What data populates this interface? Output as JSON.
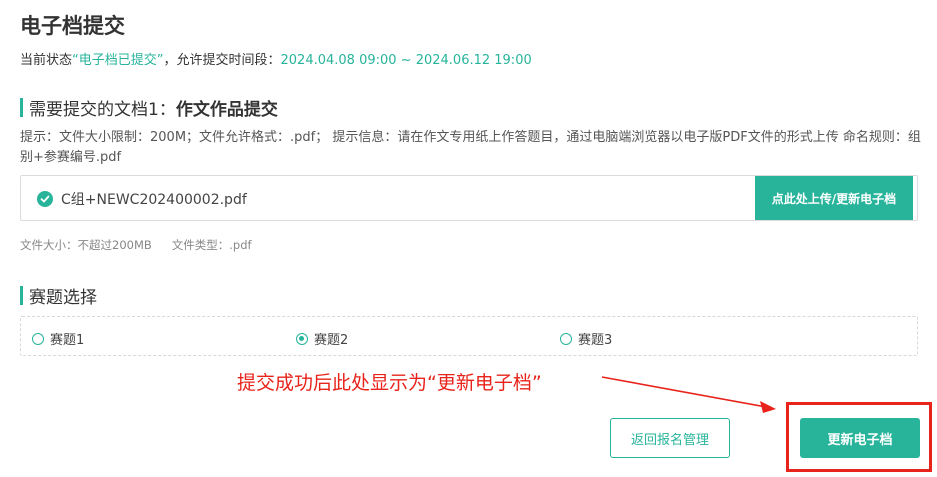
{
  "page": {
    "title": "电子档提交"
  },
  "status": {
    "prefix": "当前状态",
    "value": "“电子档已提交”",
    "window_label": "，允许提交时间段：",
    "window_value": "2024.04.08 09:00 ~ 2024.06.12 19:00"
  },
  "document_section": {
    "heading_prefix": "需要提交的文档1：",
    "heading_name": "作文作品提交",
    "tips": "提示：文件大小限制：200M；文件允许格式：.pdf； 提示信息：请在作文专用纸上作答题目，通过电脑端浏览器以电子版PDF文件的形式上传 命名规则：组别+参赛编号.pdf",
    "file_name": "C组+NEWC202400002.pdf",
    "upload_button": "点此处上传/更新电子档",
    "size_hint": "文件大小：不超过200MB",
    "type_hint": "文件类型：.pdf"
  },
  "topic_section": {
    "heading": "赛题选择",
    "options": [
      {
        "label": "赛题1",
        "checked": false
      },
      {
        "label": "赛题2",
        "checked": true
      },
      {
        "label": "赛题3",
        "checked": false
      }
    ]
  },
  "annotation": {
    "text": "提交成功后此处显示为“更新电子档”",
    "color": "#e8231b"
  },
  "actions": {
    "back_label": "返回报名管理",
    "update_label": "更新电子档"
  },
  "colors": {
    "accent": "#27b49b",
    "annotation": "#e8231b"
  },
  "icons": {
    "file_status": "check-circle-icon",
    "annotation_arrow": "arrow-icon"
  }
}
